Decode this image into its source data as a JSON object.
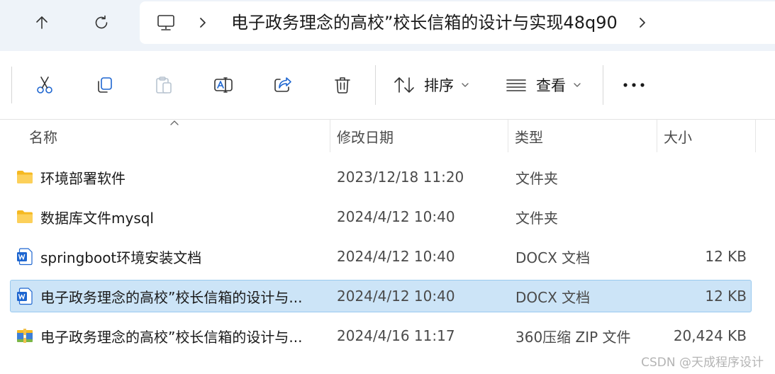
{
  "address": {
    "current_folder": "电子政务理念的高校”校长信箱的设计与实现48q90"
  },
  "toolbar": {
    "sort_label": "排序",
    "view_label": "查看"
  },
  "columns": {
    "name": "名称",
    "date": "修改日期",
    "type": "类型",
    "size": "大小"
  },
  "files": [
    {
      "icon": "folder-icon",
      "name": "环境部署软件",
      "date": "2023/12/18 11:20",
      "type": "文件夹",
      "size": ""
    },
    {
      "icon": "folder-icon",
      "name": "数据库文件mysql",
      "date": "2024/4/12 10:40",
      "type": "文件夹",
      "size": ""
    },
    {
      "icon": "word-doc-icon",
      "name": "springboot环境安装文档",
      "date": "2024/4/12 10:40",
      "type": "DOCX 文档",
      "size": "12 KB"
    },
    {
      "icon": "word-doc-icon",
      "name": "电子政务理念的高校”校长信箱的设计与...",
      "date": "2024/4/12 10:40",
      "type": "DOCX 文档",
      "size": "12 KB",
      "selected": true
    },
    {
      "icon": "zip-archive-icon",
      "name": "电子政务理念的高校”校长信箱的设计与...",
      "date": "2024/4/16 11:17",
      "type": "360压缩 ZIP 文件",
      "size": "20,424 KB"
    }
  ],
  "colors": {
    "selection_bg": "#cce4f7",
    "selection_border": "#99c9ef",
    "folder_yellow": "#f8c74a",
    "word_blue": "#1e66d0",
    "address_bg": "#eef3f9"
  },
  "watermark": "CSDN @天成程序设计"
}
